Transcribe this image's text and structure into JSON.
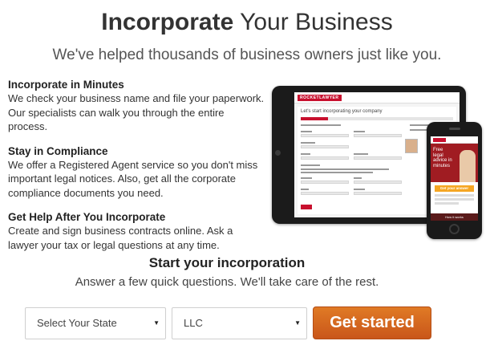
{
  "header": {
    "title_bold": "Incorporate",
    "title_rest": "Your Business",
    "subtitle": "We've helped thousands of business owners just like you."
  },
  "features": [
    {
      "heading": "Incorporate in Minutes",
      "body": "We check your business name and file your paperwork. Our specialists can walk you through the entire process."
    },
    {
      "heading": "Stay in Compliance",
      "body": "We offer a Registered Agent service so you don't miss important legal notices. Also, get all the corporate compliance documents you need."
    },
    {
      "heading": "Get Help After You Incorporate",
      "body": "Create and sign business contracts online. Ask a lawyer your tax or legal questions at any time."
    }
  ],
  "devices": {
    "tablet_logo": "ROCKETLAWYER",
    "tablet_heading": "Let's start incorporating your company",
    "phone_hero": "Free legal advice in minutes",
    "phone_button": "Get your answer",
    "phone_footer": "How it works"
  },
  "cta": {
    "title": "Start your incorporation",
    "subtitle": "Answer a few quick questions. We'll take care of the rest."
  },
  "form": {
    "state_select": "Select Your State",
    "entity_select": "LLC",
    "submit_label": "Get started"
  },
  "colors": {
    "brand_red": "#c8102e",
    "button_orange": "#d8691f"
  }
}
